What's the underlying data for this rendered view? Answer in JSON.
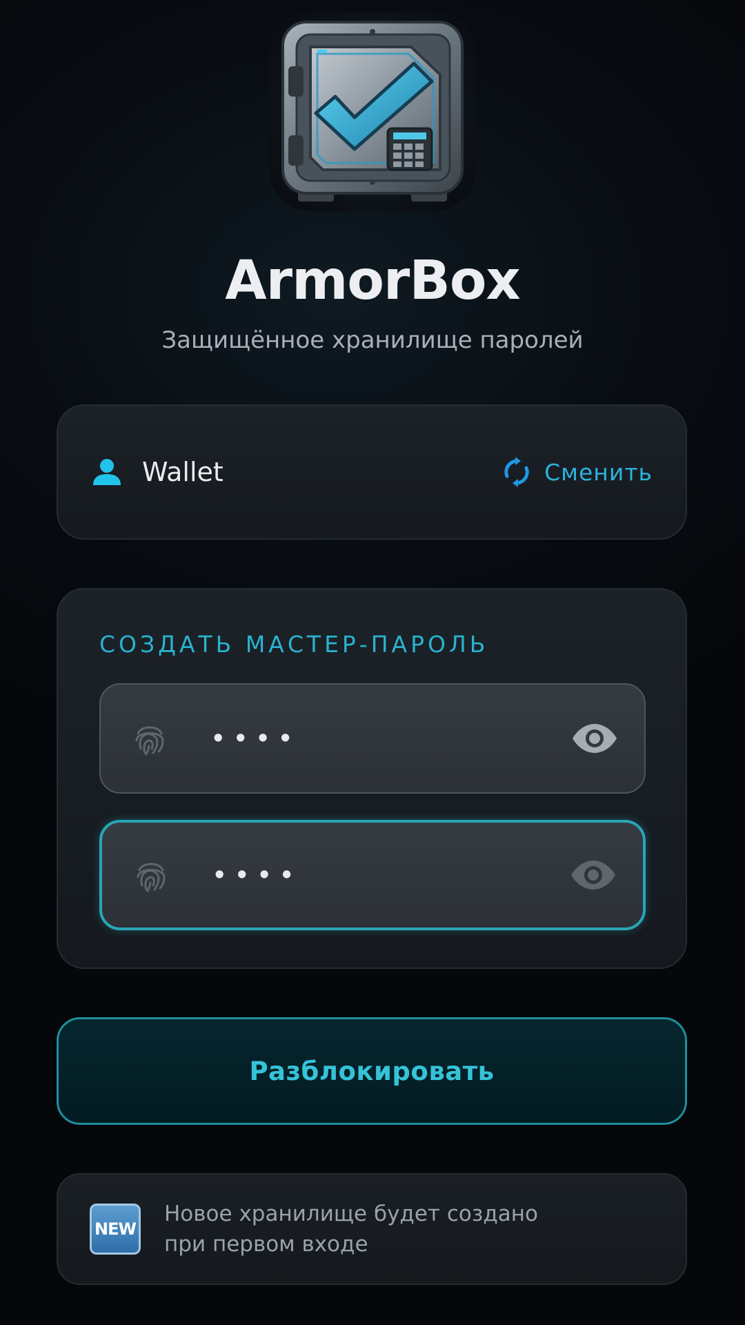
{
  "app": {
    "title": "ArmorBox",
    "subtitle": "Защищённое хранилище паролей"
  },
  "account": {
    "name": "Wallet",
    "switch_label": "Сменить",
    "icon": "user-icon",
    "switch_icon": "sync-icon"
  },
  "form": {
    "section_title": "СОЗДАТЬ МАСТЕР-ПАРОЛЬ",
    "password": {
      "value": "••••",
      "icon": "fingerprint-icon",
      "toggle_icon": "eye-icon"
    },
    "confirm_password": {
      "value": "••••",
      "icon": "fingerprint-icon",
      "toggle_icon": "eye-icon",
      "focused": true
    }
  },
  "unlock_button": {
    "label": "Разблокировать"
  },
  "info": {
    "badge": "NEW",
    "line1": "Новое хранилище будет создано",
    "line2": "при первом входе"
  },
  "colors": {
    "accent": "#2ab3cf",
    "background": "#06090d",
    "card": "#1b2228"
  }
}
